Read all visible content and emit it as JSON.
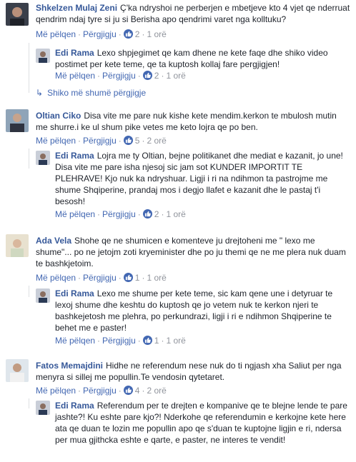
{
  "actions": {
    "like": "Më pëlqen",
    "reply": "Përgjigju",
    "sep": "·"
  },
  "more_replies": "Shiko më shumë përgjigje",
  "comments": [
    {
      "name": "Shkelzen Mulaj Zeni",
      "text": "Ç'ka ndryshoi ne perberjen e mbetjeve kto 4 vjet qe nderruat qendrim ndaj tyre si ju si Berisha apo qendrimi varet nga kolltuku?",
      "likes": "2",
      "time": "1 orë"
    },
    {
      "name": "Edi Rama",
      "text": "Lexo shpjegimet qe kam dhene ne kete faqe dhe shiko video postimet per kete teme, qe ta kuptosh kollaj fare pergjigjen!",
      "likes": "2",
      "time": "1 orë"
    },
    {
      "name": "Oltian Ciko",
      "text": "Disa vite me pare nuk kishe kete mendim.kerkon te mbulosh mutin me shurre.i ke ul shum pike vetes me keto lojra qe po ben.",
      "likes": "5",
      "time": "2 orë"
    },
    {
      "name": "Edi Rama",
      "text": "Lojra me ty Oltian, bejne politikanet dhe mediat e kazanit, jo une! Disa vite me pare isha njesoj sic jam sot KUNDER IMPORTIT TE PLEHRAVE! Kjo nuk ka ndryshuar. Ligji i ri na ndihmon ta pastrojme me shume Shqiperine, prandaj mos i degjo llafet e kazanit dhe le pastaj t'i besosh!",
      "likes": "2",
      "time": "1 orë"
    },
    {
      "name": "Ada Vela",
      "text": "Shohe qe ne shumicen e komenteve ju drejtoheni me \" lexo me shume\"... po ne jetojm zoti kryeminister dhe po ju themi qe ne me plera nuk duam te bashkjetoim.",
      "likes": "1",
      "time": "1 orë"
    },
    {
      "name": "Edi Rama",
      "text": "Lexo me shume per kete teme, sic kam qene une i detyruar te lexoj shume dhe keshtu do kuptosh qe jo vetem nuk te kerkon njeri te bashkejetosh me plehra, po perkundrazi, ligji i ri e ndihmon Shqiperine te behet me e paster!",
      "likes": "1",
      "time": "1 orë"
    },
    {
      "name": "Fatos Memajdini",
      "text": "Hidhe ne referendum nese nuk do ti ngjash xha Saliut per nga menyra si sillej me popullin.Te vendosin qytetaret.",
      "likes": "4",
      "time": "2 orë"
    },
    {
      "name": "Edi Rama",
      "text": "Referendum per te drejten e kompanive qe te blejne lende te pare jashte?! Ku eshte pare kjo?! Nderkohe qe referendumin e kerkojne kete here ata qe duan te lozin me popullin apo qe s'duan te kuptojne ligjin e ri, ndersa per mua gjithcka eshte e qarte, e paster, ne interes te vendit!",
      "likes": "",
      "time": ""
    }
  ]
}
